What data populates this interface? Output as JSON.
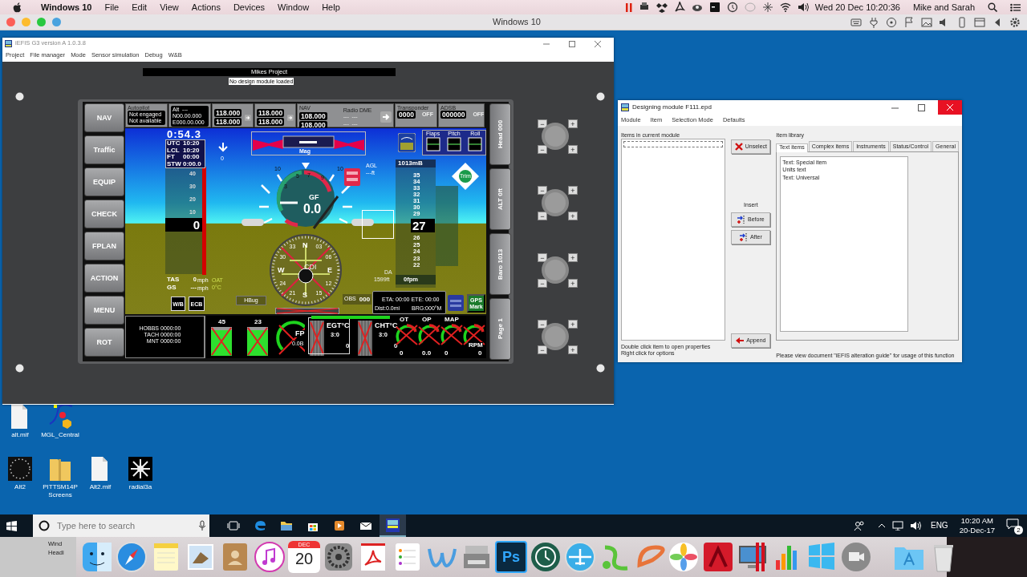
{
  "mac_menu_bar": {
    "app_name": "Windows 10",
    "menus": [
      "File",
      "Edit",
      "View",
      "Actions",
      "Devices",
      "Window",
      "Help"
    ],
    "clock": "Wed 20 Dec  10:20:36",
    "user": "Mike and Sarah"
  },
  "vm_window": {
    "title": "Windows 10"
  },
  "efis_window": {
    "title": "iEFIS G3 version A 1.0.3.8",
    "menus": [
      "Project",
      "File manager",
      "Mode",
      "Sensor simulation",
      "Debug",
      "W&B"
    ],
    "project_name": "Mikes Project",
    "module_status": "No design module loaded",
    "knobs": [
      {
        "buttons": [
          "−",
          "+",
          "−",
          "+"
        ]
      },
      {
        "buttons": [
          "−",
          "+",
          "−",
          "+"
        ]
      },
      {
        "buttons": [
          "−",
          "+",
          "−",
          "+"
        ]
      },
      {
        "buttons": [
          "−",
          "+",
          "−",
          "+"
        ]
      }
    ],
    "left_buttons": [
      "NAV",
      "Traffic",
      "EQUIP",
      "CHECK",
      "FPLAN",
      "ACTION",
      "MENU",
      "ROT"
    ],
    "right_buttons": [
      {
        "label": "Head",
        "value": "000"
      },
      {
        "label": "ALT",
        "value": "0ft"
      },
      {
        "label": "Baro",
        "value": "1013"
      },
      {
        "label": "Page",
        "value": "1"
      }
    ],
    "autopilot": {
      "title": "Autopilot",
      "lines": [
        "Not engaged",
        "Not available"
      ]
    },
    "gps": {
      "lines": [
        "Alt  ---",
        "N00.00.000",
        "E000.00.000"
      ]
    },
    "radios": [
      {
        "active": "118.000",
        "standby": "118.000"
      },
      {
        "active": "118.000",
        "standby": "118.000"
      },
      {
        "title": "NAV",
        "active": "108.000",
        "standby": "108.000"
      }
    ],
    "dme": {
      "title": "Radio DME",
      "lines": [
        "---  ---",
        "---  ---"
      ]
    },
    "transponder": {
      "title": "Transponder",
      "code": "0000",
      "mode": "OFF"
    },
    "adsb": {
      "title": "ADSB",
      "code": "000000",
      "mode": "OFF"
    },
    "pfd": {
      "timer": "0:54.3",
      "times": [
        {
          "label": "UTC",
          "value": "10:20"
        },
        {
          "label": "LCL",
          "value": "10:20"
        },
        {
          "label": "FT",
          "value": "00:00"
        },
        {
          "label": "STW",
          "value": "0:00.0"
        }
      ],
      "speed_ticks": [
        "40",
        "30",
        "20",
        "10"
      ],
      "airspeed": "0",
      "tas": {
        "label": "TAS",
        "value": "0",
        "unit": "mph"
      },
      "gs": {
        "label": "GS",
        "value": "---",
        "unit": "mph"
      },
      "oat": {
        "label": "OAT",
        "value": "0°C"
      },
      "arrow_value": "0",
      "heading_source": "Mag",
      "bank_labels": [
        "10",
        "5",
        "7",
        "9",
        "10",
        "3"
      ],
      "g_force": {
        "label": "GF",
        "value": "0.0"
      },
      "agl": {
        "label": "AGL",
        "value": "---ft"
      },
      "baro": "1013mB",
      "altitude_ticks_upper": [
        "35",
        "34",
        "33",
        "32",
        "31",
        "30",
        "29"
      ],
      "altitude": "27",
      "altitude_ticks_lower": [
        "26",
        "25",
        "24",
        "23",
        "22"
      ],
      "density_altitude": {
        "label": "DA",
        "value": "1599ft"
      },
      "vertical_speed": "0fpm",
      "trim_panels": [
        "Flaps",
        "Pitch",
        "Roll"
      ],
      "trim": "Trim",
      "compass_labels": [
        "33",
        "N",
        "03",
        "30",
        "06",
        "W",
        "E",
        "24",
        "12",
        "21",
        "15",
        "S"
      ],
      "cdi": "CDI",
      "hbug": "HBug",
      "obs": {
        "label": "OBS",
        "value": "000"
      },
      "nav_info": {
        "eta": "ETA: 00:00 ETE: 00:00",
        "dist": "Dist:0.0mi",
        "brg": "BRG:000°M"
      },
      "wb_button": "W/B",
      "ecb_button": "ECB",
      "gps_mark": "GPS Mark"
    },
    "engine": {
      "counters": [
        {
          "label": "HOBBS",
          "value": "0000:00"
        },
        {
          "label": "TACH",
          "value": "0000:00"
        },
        {
          "label": "MNT",
          "value": "0000:00"
        }
      ],
      "fuel_tanks": [
        "45",
        "23"
      ],
      "fuel_pressure": {
        "label": "FP",
        "reading": "0.0B"
      },
      "temps": [
        {
          "label": "EGT°C",
          "value": "3:0",
          "reading": "0"
        },
        {
          "label": "CHT°C",
          "value": "3:0",
          "reading": "0"
        }
      ],
      "dials": [
        {
          "label": "OT",
          "reading": "0"
        },
        {
          "label": "OP",
          "reading": "0.0"
        },
        {
          "label": "MAP",
          "reading": "0"
        },
        {
          "label": "RPM",
          "reading": "0"
        }
      ]
    }
  },
  "designer_window": {
    "title": "Designing module F111.epd",
    "menus": [
      "Module",
      "Item",
      "Selection Mode",
      "Defaults"
    ],
    "items_label": "Items in current module",
    "library_label": "Item library",
    "unselect": "Unselect",
    "insert_label": "Insert",
    "before": "Before",
    "after": "After",
    "append": "Append",
    "tabs": [
      {
        "label": "Text items",
        "selected": true
      },
      {
        "label": "Complex items",
        "selected": false
      },
      {
        "label": "Instruments",
        "selected": false
      },
      {
        "label": "Status/Control",
        "selected": false
      },
      {
        "label": "General",
        "selected": false
      }
    ],
    "library_items": [
      "Text: Special item",
      "Units text",
      "Text: Universal"
    ],
    "hints": [
      "Double click item to open properties",
      "Right click for options"
    ],
    "guide_note": "Please view document \"iEFIS alteration guide\" for usage of this function"
  },
  "desktop_icons": [
    {
      "label": "alt.mif",
      "kind": "file"
    },
    {
      "label": "MGL_Central",
      "kind": "app"
    },
    {
      "label": "Alt2",
      "kind": "dial"
    },
    {
      "label": "PITTSM14P Screens",
      "kind": "zip"
    },
    {
      "label": "Alt2.mif",
      "kind": "file"
    },
    {
      "label": "radial3a",
      "kind": "radial"
    }
  ],
  "taskbar": {
    "search": {
      "placeholder": "Type here to search"
    },
    "language": "ENG",
    "time": "10:20 AM",
    "date": "20-Dec-17",
    "notifications": "2"
  },
  "dock": {
    "preview_lines": [
      "Wind",
      "Headi"
    ],
    "calendar_month": "DEC",
    "calendar_day": "20",
    "photoshop_label": "Ps"
  }
}
